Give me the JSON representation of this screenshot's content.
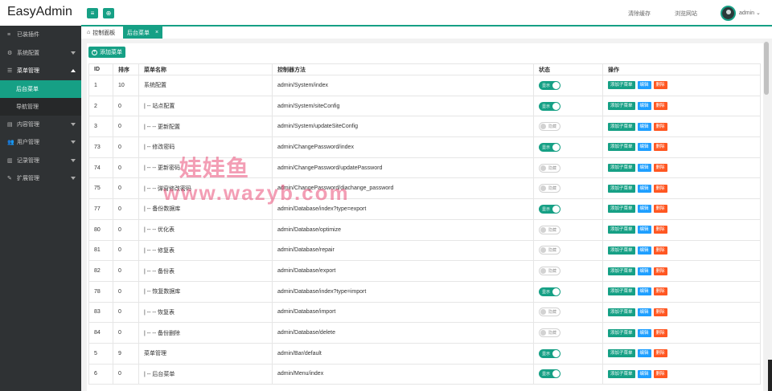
{
  "app": {
    "title": "EasyAdmin"
  },
  "header": {
    "links": [
      "清除缓存",
      "浏览网站"
    ],
    "user": "admin ⌄",
    "btn_menu_icon": "≡",
    "btn_globe_icon": "⊕"
  },
  "sidebar": {
    "items": [
      {
        "label": "已装插件",
        "icon": "≡"
      },
      {
        "label": "系统配置",
        "icon": "⚙"
      },
      {
        "label": "菜单管理",
        "icon": "☰"
      },
      {
        "label": "内容管理",
        "icon": "▤"
      },
      {
        "label": "用户管理",
        "icon": "👥"
      },
      {
        "label": "记录管理",
        "icon": "▥"
      },
      {
        "label": "扩展管理",
        "icon": "✎"
      }
    ],
    "subitems": [
      "后台菜单",
      "导航管理"
    ]
  },
  "tabs": [
    {
      "label": "控制面板",
      "icon": "⌂"
    },
    {
      "label": "后台菜单",
      "close": "×"
    }
  ],
  "toolbar": {
    "add_label": "添加菜单",
    "add_icon": "+"
  },
  "table": {
    "headers": [
      "ID",
      "排序",
      "菜单名称",
      "控制器方法",
      "状态",
      "操作"
    ],
    "switch_on": "显示",
    "switch_off": "隐藏",
    "actions": [
      "添加子菜单",
      "编辑",
      "删除"
    ],
    "rows": [
      {
        "id": "1",
        "sort": "10",
        "name": "系统配置",
        "method": "admin/System/index",
        "on": true
      },
      {
        "id": "2",
        "sort": "0",
        "name": "| -- 站点配置",
        "method": "admin/System/siteConfig",
        "on": true
      },
      {
        "id": "3",
        "sort": "0",
        "name": "| -- -- 更新配置",
        "method": "admin/System/updateSiteConfig",
        "on": false
      },
      {
        "id": "73",
        "sort": "0",
        "name": "| -- 修改密码",
        "method": "admin/ChangePassword/index",
        "on": true
      },
      {
        "id": "74",
        "sort": "0",
        "name": "| -- -- 更新密码",
        "method": "admin/ChangePassword/updatePassword",
        "on": false
      },
      {
        "id": "75",
        "sort": "0",
        "name": "| -- -- 弹窗修改密码",
        "method": "admin/ChangePassword/diachange_password",
        "on": false
      },
      {
        "id": "77",
        "sort": "0",
        "name": "| -- 备份数据库",
        "method": "admin/Database/index?type=export",
        "on": true
      },
      {
        "id": "80",
        "sort": "0",
        "name": "| -- -- 优化表",
        "method": "admin/Database/optimize",
        "on": false
      },
      {
        "id": "81",
        "sort": "0",
        "name": "| -- -- 修复表",
        "method": "admin/Database/repair",
        "on": false
      },
      {
        "id": "82",
        "sort": "0",
        "name": "| -- -- 备份表",
        "method": "admin/Database/export",
        "on": false
      },
      {
        "id": "78",
        "sort": "0",
        "name": "| -- 恢复数据库",
        "method": "admin/Database/index?type=import",
        "on": true
      },
      {
        "id": "83",
        "sort": "0",
        "name": "| -- -- 恢复表",
        "method": "admin/Database/import",
        "on": false
      },
      {
        "id": "84",
        "sort": "0",
        "name": "| -- -- 备份删除",
        "method": "admin/Database/delete",
        "on": false
      },
      {
        "id": "5",
        "sort": "9",
        "name": "菜单管理",
        "method": "admin/Bar/default",
        "on": true
      },
      {
        "id": "6",
        "sort": "0",
        "name": "| -- 后台菜单",
        "method": "admin/Menu/index",
        "on": true
      }
    ]
  },
  "watermark": {
    "line1": "娃娃鱼",
    "line2": "www.wazyb.com"
  },
  "colors": {
    "accent": "#16a085",
    "sidebar": "#2f3234",
    "edit": "#1e9fff",
    "delete": "#ff5722"
  }
}
